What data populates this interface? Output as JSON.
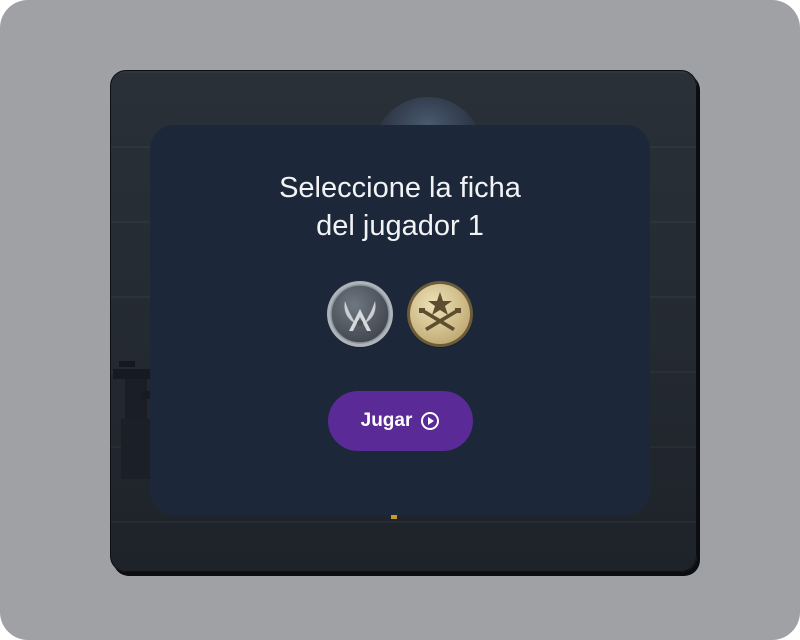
{
  "modal": {
    "title_line1": "Seleccione la ficha",
    "title_line2": "del jugador 1"
  },
  "tokens": [
    {
      "name": "counter-terrorist-token",
      "icon": "counter-terrorist-emblem-icon",
      "color": "#8a9099"
    },
    {
      "name": "terrorist-token",
      "icon": "terrorist-emblem-icon",
      "color": "#d8c594"
    }
  ],
  "play_button": {
    "label": "Jugar",
    "icon": "play-circle-icon",
    "color": "#5a2a96"
  },
  "colors": {
    "page_background": "#a0a1a5",
    "modal_background": "#1c2839",
    "title_text": "#f2f3f5"
  }
}
